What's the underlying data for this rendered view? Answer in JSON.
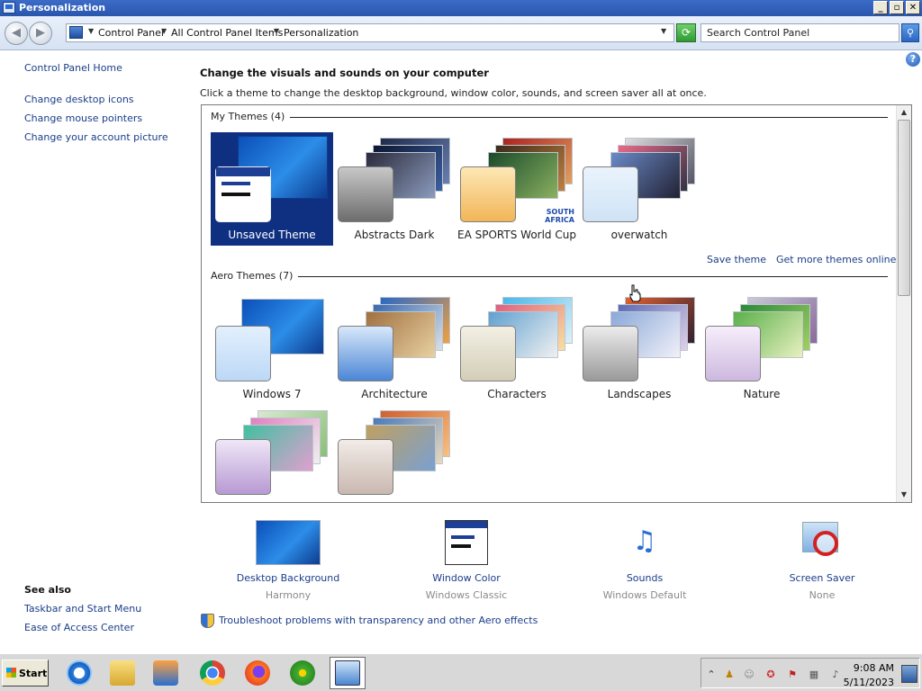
{
  "window": {
    "title": "Personalization",
    "controls": [
      "_",
      "▫",
      "✕"
    ]
  },
  "address": {
    "breadcrumbs": [
      "Control Panel",
      "All Control Panel Items",
      "Personalization"
    ],
    "search_placeholder": "Search Control Panel"
  },
  "left": {
    "home": "Control Panel Home",
    "links": [
      "Change desktop icons",
      "Change mouse pointers",
      "Change your account picture"
    ],
    "see_also_title": "See also",
    "see_also": [
      "Taskbar and Start Menu",
      "Ease of Access Center"
    ]
  },
  "main": {
    "title": "Change the visuals and sounds on your computer",
    "subtitle": "Click a theme to change the desktop background, window color, sounds, and screen saver all at once.",
    "my_themes_header": "My Themes (4)",
    "aero_header": "Aero Themes (7)",
    "save_theme": "Save theme",
    "get_more": "Get more themes online",
    "my_themes": [
      {
        "label": "Unsaved Theme",
        "selected": true
      },
      {
        "label": "Abstracts Dark"
      },
      {
        "label": "EA SPORTS World Cup",
        "badge": "SOUTH AFRICA"
      },
      {
        "label": "overwatch"
      }
    ],
    "aero_themes": [
      {
        "label": "Windows 7"
      },
      {
        "label": "Architecture"
      },
      {
        "label": "Characters"
      },
      {
        "label": "Landscapes"
      },
      {
        "label": "Nature"
      },
      {
        "label": ""
      },
      {
        "label": ""
      }
    ]
  },
  "tiles": [
    {
      "label": "Desktop Background",
      "sub": "Harmony"
    },
    {
      "label": "Window Color",
      "sub": "Windows Classic"
    },
    {
      "label": "Sounds",
      "sub": "Windows Default"
    },
    {
      "label": "Screen Saver",
      "sub": "None"
    }
  ],
  "troubleshoot": "Troubleshoot problems with transparency and other Aero effects",
  "taskbar": {
    "start": "Start",
    "time": "9:08 AM",
    "date": "5/11/2023"
  }
}
